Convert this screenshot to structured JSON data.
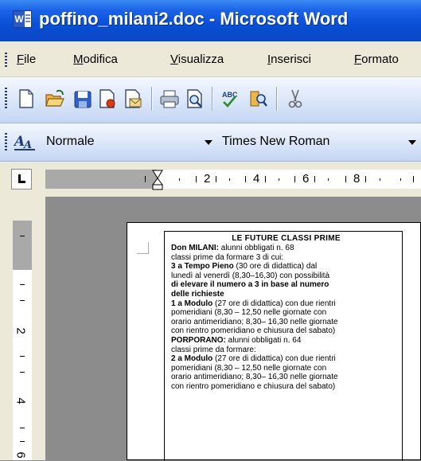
{
  "window": {
    "title": "poffino_milani2.doc - Microsoft Word"
  },
  "menu": [
    {
      "label": "File",
      "u": "F",
      "rest": "ile"
    },
    {
      "label": "Modifica",
      "u": "M",
      "rest": "odifica"
    },
    {
      "label": "Visualizza",
      "u": "V",
      "rest": "isualizza"
    },
    {
      "label": "Inserisci",
      "u": "I",
      "rest": "nserisci"
    },
    {
      "label": "Formato",
      "u": "F",
      "rest": "ormato"
    }
  ],
  "toolbar": {
    "style_value": "Normale",
    "font_value": "Times New Roman",
    "buttons": [
      "new-icon",
      "open-icon",
      "save-icon",
      "permission-icon",
      "email-icon",
      "print-icon",
      "print-preview-icon",
      "spelling-icon",
      "research-icon",
      "cut-icon"
    ]
  },
  "ruler": {
    "labels": [
      "1",
      "2",
      "4",
      "6",
      "8"
    ],
    "v_labels": [
      "2",
      "4",
      "6"
    ]
  },
  "document": {
    "title": "LE FUTURE CLASSI PRIME",
    "lines": [
      {
        "bold": "Don MILANI:",
        "text": "   alunni obbligati n. 68"
      },
      {
        "bold": "",
        "text": "classi prime da formare 3 di cui:"
      },
      {
        "bold": "3 a Tempo Pieno",
        "text": " (30 ore di didattica) dal"
      },
      {
        "bold": "",
        "text": "lunedì al venerdì (8,30–16,30) con possibilità"
      },
      {
        "bold": "di elevare il numero a 3 in base al numero",
        "text": ""
      },
      {
        "bold": "delle richieste",
        "text": ""
      },
      {
        "bold": "1 a Modulo",
        "text": " (27 ore di didattica) con due rientri"
      },
      {
        "bold": "",
        "text": "pomeridiani (8,30 – 12,50 nelle giornate con"
      },
      {
        "bold": "",
        "text": "orario antimeridiano; 8,30– 16,30 nelle giornate"
      },
      {
        "bold": "",
        "text": "con rientro pomeridiano e chiusura del sabato)"
      },
      {
        "bold": "PORPORANO:",
        "text": " alunni obbligati n. 64"
      },
      {
        "bold": "",
        "text": "classi prime da formare:"
      },
      {
        "bold": "2 a Modulo",
        "text": " (27 ore di didattica) con due rientri"
      },
      {
        "bold": "",
        "text": "pomeridiani (8,30 – 12,50 nelle giornate con"
      },
      {
        "bold": "",
        "text": "orario antimeridiano; 8,30– 16,30 nelle giornate"
      },
      {
        "bold": "",
        "text": "con rientro pomeridiano e chiusura del sabato)"
      }
    ]
  }
}
